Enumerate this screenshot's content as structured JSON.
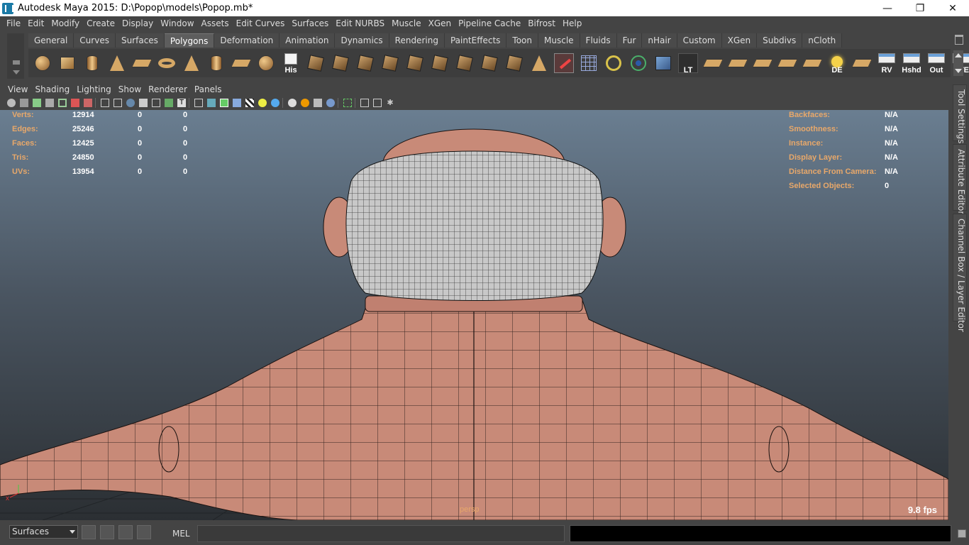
{
  "window": {
    "title": "Autodesk Maya 2015: D:\\Popop\\models\\Popop.mb*",
    "controls": [
      "minimize",
      "maximize",
      "close"
    ]
  },
  "menubar": [
    "File",
    "Edit",
    "Modify",
    "Create",
    "Display",
    "Window",
    "Assets",
    "Edit Curves",
    "Surfaces",
    "Edit NURBS",
    "Muscle",
    "XGen",
    "Pipeline Cache",
    "Bifrost",
    "Help"
  ],
  "shelf": {
    "tabs": [
      "General",
      "Curves",
      "Surfaces",
      "Polygons",
      "Deformation",
      "Animation",
      "Dynamics",
      "Rendering",
      "PaintEffects",
      "Toon",
      "Muscle",
      "Fluids",
      "Fur",
      "nHair",
      "Custom",
      "XGen",
      "Subdivs",
      "nCloth"
    ],
    "active_tab": "Polygons",
    "button_labels": {
      "history": "His",
      "lt": "LT",
      "de": "DE",
      "rv": "RV",
      "hshd": "Hshd",
      "out": "Out",
      "ute": "UTE"
    }
  },
  "panel": {
    "menu": [
      "View",
      "Shading",
      "Lighting",
      "Show",
      "Renderer",
      "Panels"
    ]
  },
  "hud": {
    "left": [
      {
        "label": "Verts:",
        "values": [
          "12914",
          "0",
          "0"
        ]
      },
      {
        "label": "Edges:",
        "values": [
          "25246",
          "0",
          "0"
        ]
      },
      {
        "label": "Faces:",
        "values": [
          "12425",
          "0",
          "0"
        ]
      },
      {
        "label": "Tris:",
        "values": [
          "24850",
          "0",
          "0"
        ]
      },
      {
        "label": "UVs:",
        "values": [
          "13954",
          "0",
          "0"
        ]
      }
    ],
    "right": [
      {
        "label": "Backfaces:",
        "value": "N/A"
      },
      {
        "label": "Smoothness:",
        "value": "N/A"
      },
      {
        "label": "Instance:",
        "value": "N/A"
      },
      {
        "label": "Display Layer:",
        "value": "N/A"
      },
      {
        "label": "Distance From Camera:",
        "value": "N/A"
      },
      {
        "label": "Selected Objects:",
        "value": "0"
      }
    ],
    "camera": "persp",
    "fps": "9.8 fps"
  },
  "side_tabs": [
    "Tool Settings",
    "Attribute Editor",
    "Channel Box / Layer Editor"
  ],
  "command_line": {
    "mode": "Surfaces",
    "language": "MEL"
  },
  "colors": {
    "hud_label": "#e8a86a",
    "skin": "#c88a78",
    "hair": "#c8c8c8"
  }
}
